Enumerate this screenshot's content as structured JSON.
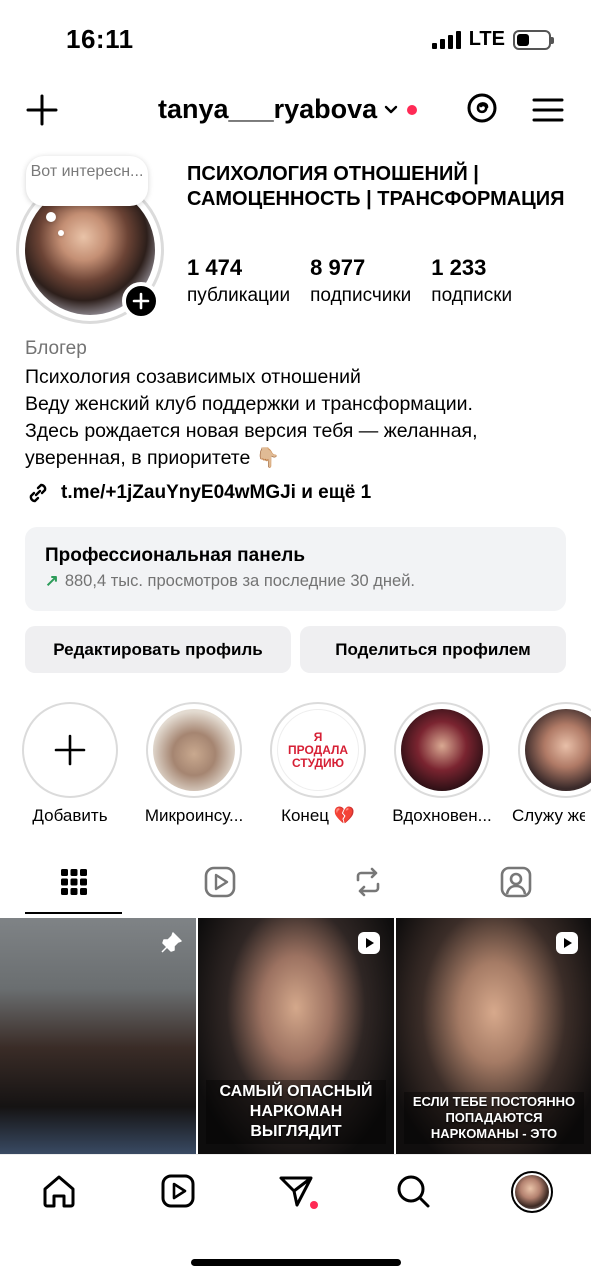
{
  "status_bar": {
    "time": "16:11",
    "network": "LTE",
    "battery_level": 0.4
  },
  "header": {
    "username": "tanya___ryabova"
  },
  "profile": {
    "note": "Вот интересн...",
    "title": "ПСИХОЛОГИЯ ОТНОШЕНИЙ | САМОЦЕННОСТЬ | ТРАНСФОРМАЦИЯ",
    "stats": [
      {
        "value": "1 474",
        "label": "публикации"
      },
      {
        "value": "8 977",
        "label": "подписчики"
      },
      {
        "value": "1 233",
        "label": "подписки"
      }
    ],
    "category": "Блогер",
    "bio_lines": [
      "Психология созависимых отношений",
      "Веду женский клуб поддержки и трансформации.",
      "Здесь рождается новая версия тебя — желанная,",
      "уверенная, в приоритете 👇🏼"
    ],
    "link": "t.me/+1jZauYnyE04wMGJi и ещё 1"
  },
  "pro_panel": {
    "title": "Профессиональная панель",
    "subtitle": "880,4 тыс. просмотров за последние 30 дней."
  },
  "buttons": {
    "edit": "Редактировать профиль",
    "share": "Поделиться профилем"
  },
  "highlights": [
    {
      "label": "Добавить"
    },
    {
      "label": "Микроинсу..."
    },
    {
      "label": "Конец 💔",
      "cover_text": "Я ПРОДАЛА СТУДИЮ"
    },
    {
      "label": "Вдохновен..."
    },
    {
      "label": "Служу же"
    }
  ],
  "tabs": [
    "grid-icon",
    "reels-icon",
    "repost-icon",
    "tagged-icon"
  ],
  "posts": [
    {
      "type": "pinned",
      "caption": ""
    },
    {
      "type": "reel",
      "caption": "САМЫЙ ОПАСНЫЙ НАРКОМАН ВЫГЛЯДИТ"
    },
    {
      "type": "reel",
      "caption": "ЕСЛИ ТЕБЕ ПОСТОЯННО ПОПАДАЮТСЯ НАРКОМАНЫ - ЭТО"
    }
  ],
  "colors": {
    "notification_dot": "#ff2a55",
    "growth_arrow": "#2d9c5a",
    "panel_bg": "#f2f3f5"
  }
}
